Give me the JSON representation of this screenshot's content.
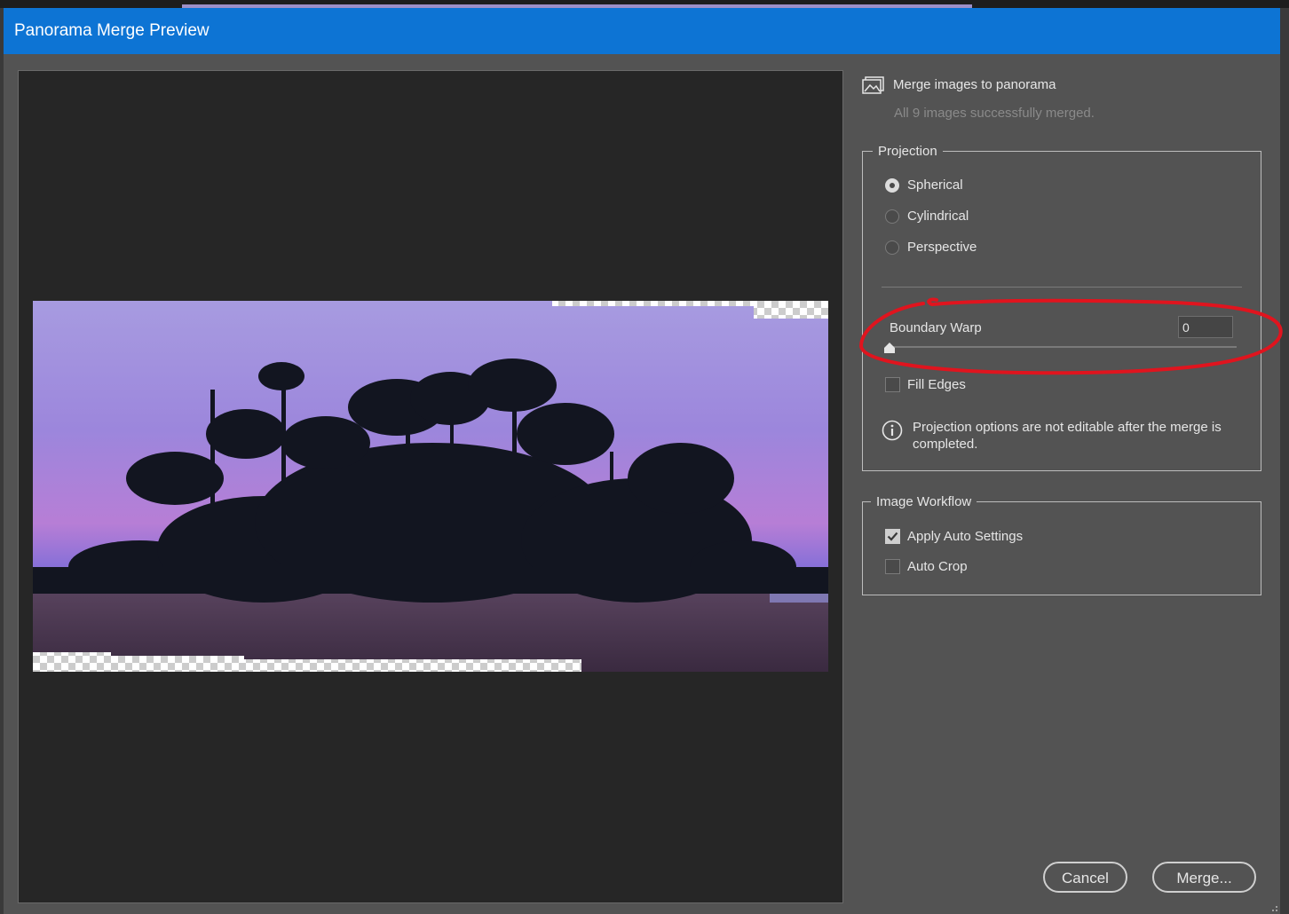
{
  "window": {
    "title": "Panorama Merge Preview"
  },
  "panel": {
    "heading_icon": "merge-images-icon",
    "heading": "Merge images to panorama",
    "status": "All 9 images successfully merged."
  },
  "projection": {
    "legend": "Projection",
    "options": [
      {
        "label": "Spherical",
        "selected": true
      },
      {
        "label": "Cylindrical",
        "selected": false
      },
      {
        "label": "Perspective",
        "selected": false
      }
    ],
    "boundary_warp": {
      "label": "Boundary Warp",
      "value": "0"
    },
    "fill_edges": {
      "label": "Fill Edges",
      "checked": false
    },
    "info_icon": "info-icon",
    "info_line1": "Projection options are not editable after the merge is",
    "info_line2": "completed."
  },
  "workflow": {
    "legend": "Image Workflow",
    "apply_auto": {
      "label": "Apply Auto Settings",
      "checked": true
    },
    "auto_crop": {
      "label": "Auto Crop",
      "checked": false
    }
  },
  "buttons": {
    "cancel": "Cancel",
    "merge": "Merge..."
  },
  "colors": {
    "titlebar": "#0d74d4",
    "panel_bg": "#535353",
    "preview_bg": "#262626",
    "annotation": "#e0141e"
  }
}
